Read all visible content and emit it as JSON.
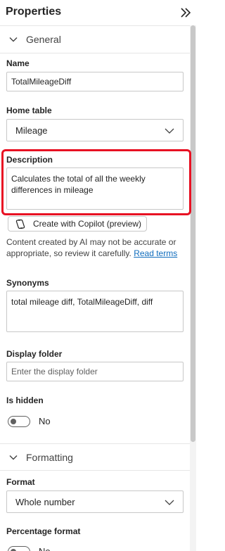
{
  "panel": {
    "title": "Properties",
    "collapse_icon": "double-chevron-right-icon"
  },
  "general": {
    "section_label": "General",
    "name_label": "Name",
    "name_value": "TotalMileageDiff",
    "home_table_label": "Home table",
    "home_table_value": "Mileage",
    "description_label": "Description",
    "description_value": "Calculates the total of all the weekly differences in mileage",
    "copilot_button": "Create with Copilot (preview)",
    "ai_note": "Content created by AI may not be accurate or appropriate, so review it carefully.",
    "ai_note_link": "Read terms",
    "synonyms_label": "Synonyms",
    "synonyms_value": "total mileage diff, TotalMileageDiff, diff",
    "display_folder_label": "Display folder",
    "display_folder_placeholder": "Enter the display folder",
    "is_hidden_label": "Is hidden",
    "is_hidden_value": "No"
  },
  "formatting": {
    "section_label": "Formatting",
    "format_label": "Format",
    "format_value": "Whole number",
    "percentage_label": "Percentage format",
    "percentage_value": "No"
  },
  "colors": {
    "highlight": "#e81123",
    "link": "#0f6cbd"
  }
}
